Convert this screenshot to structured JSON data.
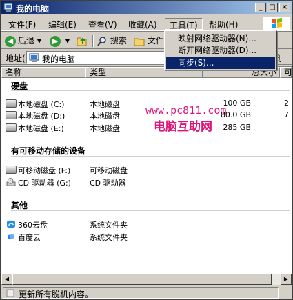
{
  "window": {
    "title": "我的电脑",
    "min_glyph": "_",
    "max_glyph": "□",
    "close_glyph": "×"
  },
  "menubar": [
    {
      "label": "文件(F)"
    },
    {
      "label": "编辑(E)"
    },
    {
      "label": "查看(V)"
    },
    {
      "label": "收藏(A)"
    },
    {
      "label": "工具(T)"
    },
    {
      "label": "帮助(H)"
    }
  ],
  "toolbar": {
    "back": "后退",
    "search": "搜索",
    "folders": "文件"
  },
  "address": {
    "label": "地址(D)",
    "value": "我的电脑",
    "go": "到"
  },
  "columns": {
    "name": "名称",
    "type": "类型",
    "total": "总大小",
    "free": "可"
  },
  "groups": {
    "hard_disks": "硬盘",
    "removable": "有可移动存储的设备",
    "other": "其他"
  },
  "hard_disks": [
    {
      "name": "本地磁盘 (C:)",
      "type": "本地磁盘",
      "total": "100 GB",
      "free": "2"
    },
    {
      "name": "本地磁盘 (D:)",
      "type": "本地磁盘",
      "total": "80.0 GB",
      "free": "7"
    },
    {
      "name": "本地磁盘 (E:)",
      "type": "本地磁盘",
      "total": "285 GB",
      "free": ""
    }
  ],
  "removable": [
    {
      "name": "可移动磁盘 (F:)",
      "type": "可移动磁盘"
    },
    {
      "name": "CD 驱动器 (G:)",
      "type": "CD 驱动器"
    }
  ],
  "other": [
    {
      "name": "360云盘",
      "type": "系统文件夹"
    },
    {
      "name": "百度云",
      "type": "系统文件夹"
    }
  ],
  "watermark": {
    "url": "www.pc811.com",
    "text": "电脑互助网"
  },
  "tools_menu": [
    {
      "label": "映射网络驱动器(N)..."
    },
    {
      "label": "断开网络驱动器(D)..."
    },
    {
      "label": "同步(S)..."
    }
  ],
  "status": {
    "text": "更新所有脱机内容。"
  },
  "colors": {
    "titlebar_start": "#0a246a",
    "titlebar_end": "#a6caf0",
    "highlight": "#0a246a",
    "watermark": "#e0157a"
  }
}
